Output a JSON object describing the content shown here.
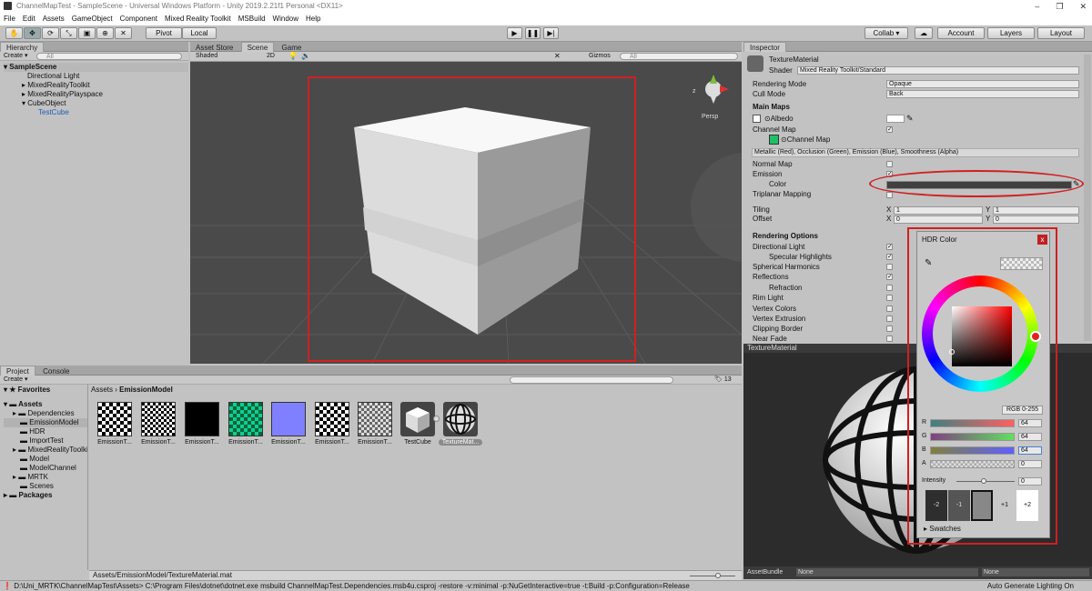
{
  "window": {
    "title": "ChannelMapTest - SampleScene - Universal Windows Platform - Unity 2019.2.21f1 Personal <DX11>",
    "controls": [
      "–",
      "❐",
      "✕"
    ]
  },
  "menu": [
    "File",
    "Edit",
    "Assets",
    "GameObject",
    "Component",
    "Mixed Reality Toolkit",
    "MSBuild",
    "Window",
    "Help"
  ],
  "toolbar": {
    "pivot": "Pivot",
    "local": "Local",
    "collab": "Collab ▾",
    "account": "Account",
    "layers": "Layers",
    "layout": "Layout"
  },
  "hierarchy": {
    "tab": "Hierarchy",
    "create": "Create ▾",
    "search": "All",
    "scene": "SampleScene",
    "items": [
      "Directional Light",
      "MixedRealityToolkit",
      "MixedRealityPlayspace",
      "CubeObject",
      "TestCube"
    ]
  },
  "scene": {
    "tabs": [
      "Asset Store",
      "Scene",
      "Game"
    ],
    "shading": "Shaded",
    "mode2d": "2D",
    "gizmos": "Gizmos",
    "search": "All",
    "persp": "Persp"
  },
  "inspector": {
    "tab": "Inspector",
    "material_name": "TextureMaterial",
    "shader_label": "Shader",
    "shader_value": "Mixed Reality Toolkit/Standard",
    "rendering_mode_label": "Rendering Mode",
    "rendering_mode_value": "Opaque",
    "cull_mode_label": "Cull Mode",
    "cull_mode_value": "Back",
    "main_maps": "Main Maps",
    "albedo": "Albedo",
    "channel_map": "Channel Map",
    "channel_map_tex": "Channel Map",
    "channel_hint": "Metallic (Red), Occlusion (Green), Emission (Blue), Smoothness (Alpha)",
    "normal_map": "Normal Map",
    "emission": "Emission",
    "color": "Color",
    "triplanar": "Triplanar Mapping",
    "tiling": "Tiling",
    "offset": "Offset",
    "tiling_x": "1",
    "tiling_y": "1",
    "offset_x": "0",
    "offset_y": "0",
    "rendering_options": "Rendering Options",
    "directional_light": "Directional Light",
    "specular": "Specular Highlights",
    "spherical": "Spherical Harmonics",
    "reflections": "Reflections",
    "refraction": "Refraction",
    "rim_light": "Rim Light",
    "vertex_colors": "Vertex Colors",
    "vertex_extrusion": "Vertex Extrusion",
    "clipping_border": "Clipping Border",
    "near_fade": "Near Fade",
    "preview_title": "TextureMaterial",
    "asset_bundle": "AssetBundle",
    "bundle_value": "None",
    "bundle_variant": "None",
    "auto_lighting": "Auto Generate Lighting On"
  },
  "hdr": {
    "title": "HDR Color",
    "mode": "RGB 0-255",
    "r": "64",
    "g": "64",
    "b": "64",
    "a": "0",
    "intensity_label": "Intensity",
    "intensity": "0",
    "swatch_labels": [
      "-2",
      "-1",
      "",
      "+1",
      "+2"
    ],
    "swatches_label": "Swatches",
    "accent": "#dd2222"
  },
  "project": {
    "tabs": [
      "Project",
      "Console"
    ],
    "create": "Create ▾",
    "favorites": "Favorites",
    "assets": "Assets",
    "tree": [
      "Dependencies",
      "EmissionModel",
      "HDR",
      "ImportTest",
      "MixedRealityToolki",
      "Model",
      "ModelChannel",
      "MRTK",
      "Scenes"
    ],
    "packages": "Packages",
    "breadcrumb_root": "Assets",
    "breadcrumb_leaf": "EmissionModel",
    "count": "13",
    "files": [
      "EmissionT...",
      "EmissionT...",
      "EmissionT...",
      "EmissionT...",
      "EmissionT...",
      "EmissionT...",
      "EmissionT...",
      "TestCube",
      "TextureMat..."
    ],
    "path": "Assets/EmissionModel/TextureMaterial.mat"
  },
  "status": "D:\\Uni_MRTK\\ChannelMapTest\\Assets> C:\\Program Files\\dotnet\\dotnet.exe msbuild ChannelMapTest.Dependencies.msb4u.csproj -restore  -v:minimal -p:NuGetInteractive=true  -t:Build -p:Configuration=Release"
}
